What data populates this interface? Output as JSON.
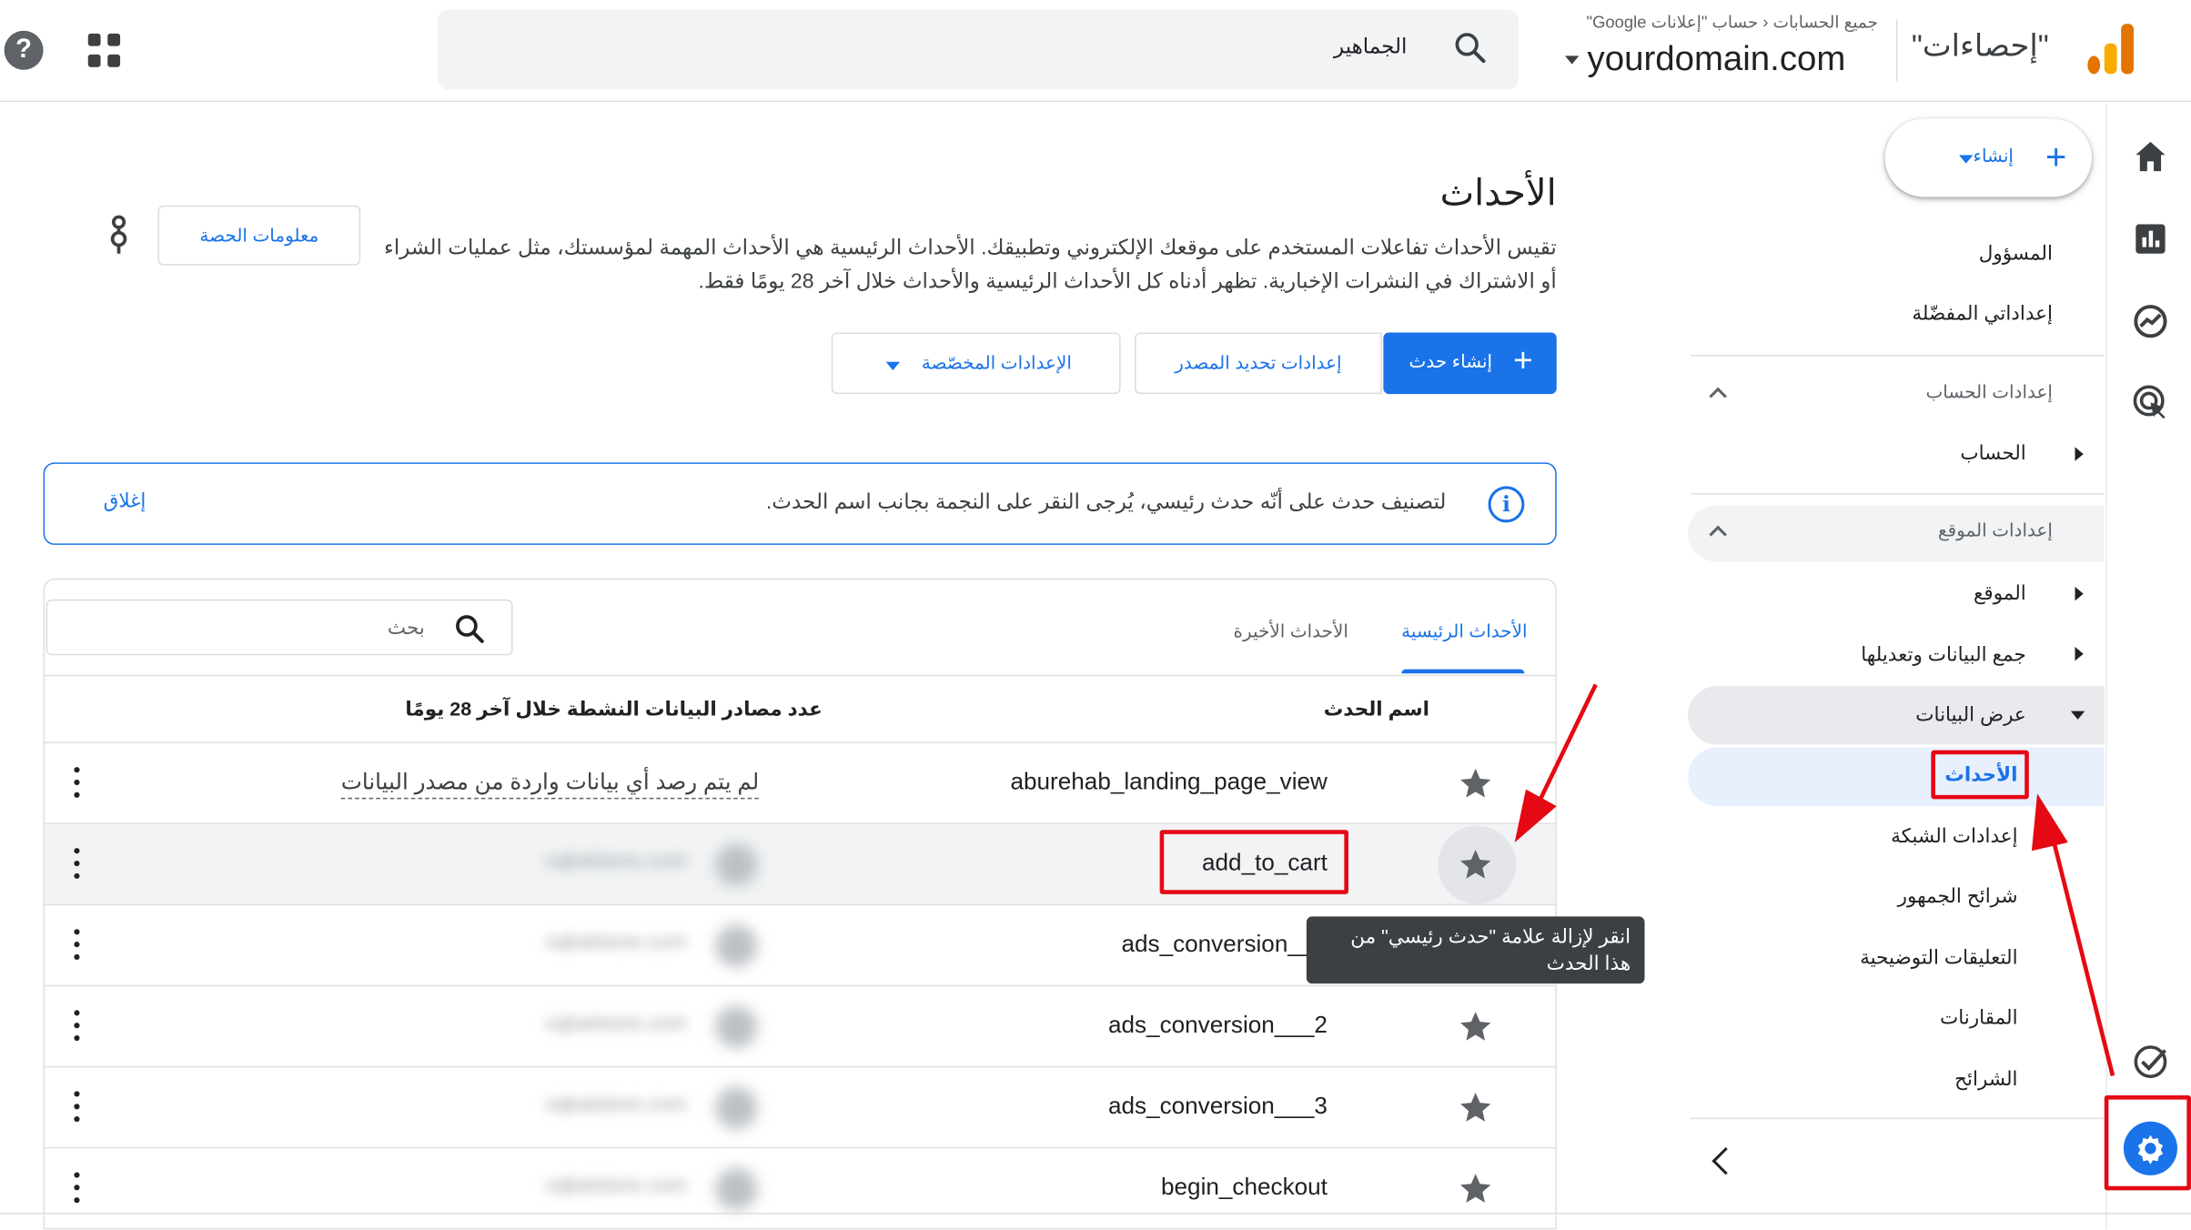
{
  "topbar": {
    "help_icon": "help-icon",
    "apps_icon": "apps-grid-icon",
    "search_value": "الجماهير",
    "product_name": "\"إحصاءات\"",
    "breadcrumb": "جميع الحسابات  ‹  حساب \"إعلانات Google\"",
    "property_name": "yourdomain.com"
  },
  "nav": {
    "create_label": "إنشاء",
    "items": {
      "admin": "المسؤول",
      "my_prefs": "إعداداتي المفضّلة",
      "account_settings": "إعدادات الحساب",
      "account": "الحساب",
      "property_settings": "إعدادات الموقع",
      "property": "الموقع",
      "data_collection": "جمع البيانات وتعديلها",
      "data_display": "عرض البيانات",
      "events": "الأحداث",
      "channel_groups": "إعدادات الشبكة",
      "audiences": "شرائح الجمهور",
      "annotations": "التعليقات التوضيحية",
      "comparisons": "المقارنات",
      "segments": "الشرائح"
    }
  },
  "main": {
    "title": "الأحداث",
    "description": "تقيس الأحداث تفاعلات المستخدم على موقعك الإلكتروني وتطبيقك. الأحداث الرئيسية هي الأحداث المهمة لمؤسستك، مثل عمليات الشراء أو الاشتراك في النشرات الإخبارية. تظهر أدناه كل الأحداث الرئيسية والأحداث خلال آخر 28 يومًا فقط.",
    "quota_button": "معلومات الحصة",
    "create_event_button": "إنشاء حدث",
    "source_settings_button": "إعدادات تحديد المصدر",
    "custom_settings_button": "الإعدادات المخصّصة",
    "banner_text": "لتصنيف حدث على أنّه حدث رئيسي، يُرجى النقر على النجمة بجانب اسم الحدث.",
    "banner_close": "إغلاق",
    "tabs": [
      "الأحداث الرئيسية",
      "الأحداث الأخيرة"
    ],
    "search_placeholder": "بحث",
    "columns": {
      "name": "اسم الحدث",
      "count": "عدد مصادر البيانات النشطة خلال آخر 28 يومًا"
    },
    "rows": [
      {
        "name": "aburehab_landing_page_view",
        "status": "لم يتم رصد أي بيانات واردة من مصدر البيانات"
      },
      {
        "name": "add_to_cart",
        "status": "xqbalstore.com"
      },
      {
        "name": "ads_conversion___",
        "status": "xqbalstore.com"
      },
      {
        "name": "ads_conversion___2",
        "status": "xqbalstore.com"
      },
      {
        "name": "ads_conversion___3",
        "status": "xqbalstore.com"
      },
      {
        "name": "begin_checkout",
        "status": "xqbalstore.com"
      }
    ],
    "tooltip": "انقر لإزالة علامة \"حدث رئيسي\" من هذا الحدث"
  },
  "colors": {
    "accent": "#1a73e8",
    "annotation_red": "#e50914",
    "logo_orange": "#f9ab00",
    "logo_dark_orange": "#e37400"
  }
}
